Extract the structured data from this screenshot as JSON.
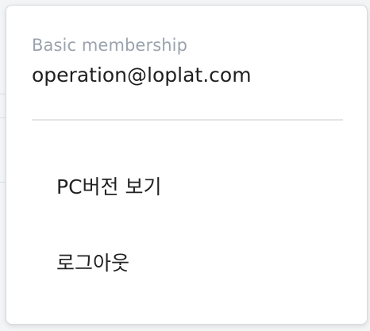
{
  "account": {
    "membership_label": "Basic membership",
    "email": "operation@loplat.com"
  },
  "menu": {
    "items": [
      {
        "label": "PC버전 보기"
      },
      {
        "label": "로그아웃"
      }
    ]
  }
}
